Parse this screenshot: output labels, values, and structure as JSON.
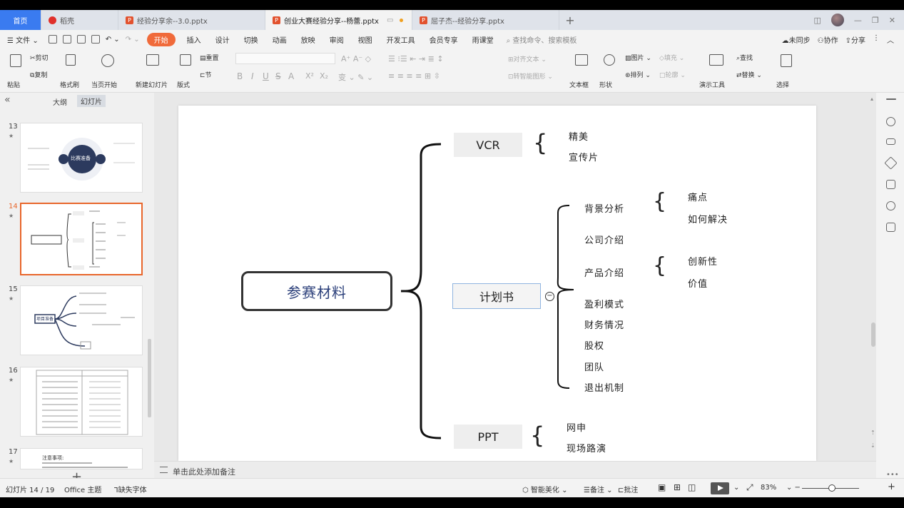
{
  "tabs": {
    "home": "首页",
    "items": [
      {
        "label": "稻壳",
        "icon": "daoke-icon"
      },
      {
        "label": "经验分享余--3.0.pptx",
        "icon": "pptx-icon"
      },
      {
        "label": "创业大赛经验分享--杨蕾.pptx",
        "icon": "pptx-icon"
      },
      {
        "label": "屈子杰--经验分享.pptx",
        "icon": "pptx-icon"
      }
    ],
    "add": "+"
  },
  "menu": {
    "file": "文件",
    "items": [
      "开始",
      "插入",
      "设计",
      "切换",
      "动画",
      "放映",
      "审阅",
      "视图",
      "开发工具",
      "会员专享",
      "雨课堂"
    ],
    "search": "查找命令、搜索模板",
    "right": [
      "未同步",
      "协作",
      "分享"
    ]
  },
  "ribbon": {
    "paste": "粘贴",
    "cut": "剪切",
    "copy": "复制",
    "format_painter": "格式刷",
    "from_current": "当页开始",
    "new_slide": "新建幻灯片",
    "layout": "版式",
    "section": "节",
    "reset": "重置",
    "align_text": "对齐文本",
    "convert_smartart": "转智能图形",
    "textbox": "文本框",
    "shape": "形状",
    "picture": "图片",
    "fill": "填充",
    "arrange": "排列",
    "outline": "轮廓",
    "presenter_tools": "演示工具",
    "find": "查找",
    "replace": "替换",
    "select": "选择"
  },
  "left_panel": {
    "tab_outline": "大纲",
    "tab_slides": "幻灯片",
    "thumbnails": [
      {
        "num": "13",
        "center_text": "比赛准备"
      },
      {
        "num": "14",
        "selected": true
      },
      {
        "num": "15",
        "center_text": "项目准备"
      },
      {
        "num": "16"
      },
      {
        "num": "17",
        "text": "注意事项:"
      }
    ],
    "add": "+"
  },
  "slide": {
    "root": "参赛材料",
    "branches": [
      {
        "label": "VCR",
        "leaves": [
          "精美",
          "宣传片"
        ]
      },
      {
        "label": "计划书",
        "children": [
          {
            "label": "背景分析",
            "leaves": [
              "痛点",
              "如何解决"
            ]
          },
          {
            "label": "公司介绍"
          },
          {
            "label": "产品介绍",
            "leaves": [
              "创新性",
              "价值"
            ]
          },
          {
            "label": "盈利模式"
          },
          {
            "label": "财务情况"
          },
          {
            "label": "股权"
          },
          {
            "label": "团队"
          },
          {
            "label": "退出机制"
          }
        ]
      },
      {
        "label": "PPT",
        "leaves": [
          "网申",
          "现场路演"
        ]
      }
    ],
    "collapse_symbol": "−"
  },
  "notes_placeholder": "单击此处添加备注",
  "status": {
    "slide_counter": "幻灯片 14 / 19",
    "theme": "Office 主题",
    "missing_font": "缺失字体",
    "smart_beautify": "智能美化",
    "notes": "备注",
    "comments": "批注",
    "zoom": "83%"
  }
}
